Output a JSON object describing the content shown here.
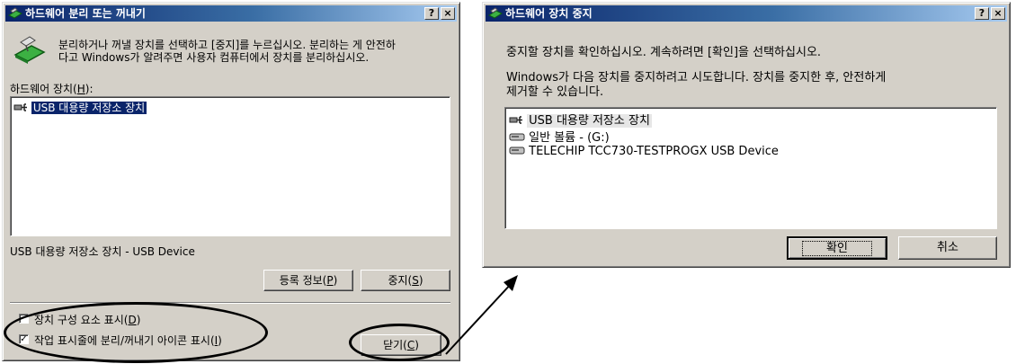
{
  "dialog1": {
    "title": "하드웨어 분리 또는 꺼내기",
    "help_btn": "?",
    "close_btn": "×",
    "instruction_line1": "분리하거나 꺼낼 장치를 선택하고 [중지]를 누르십시오. 분리하는 게 안전하",
    "instruction_line2": "다고 Windows가 알려주면 사용자 컴퓨터에서 장치를 분리하십시오.",
    "list_label_pre": "하드웨어 장치(",
    "list_label_key": "H",
    "list_label_post": "):",
    "devices": [
      "USB 대용량 저장소 장치"
    ],
    "device_description": "USB 대용량 저장소 장치 - USB Device",
    "properties_btn_pre": "등록 정보(",
    "properties_btn_key": "P",
    "properties_btn_post": ")",
    "stop_btn_pre": "중지(",
    "stop_btn_key": "S",
    "stop_btn_post": ")",
    "show_components_pre": "장치 구성 요소 표시(",
    "show_components_key": "D",
    "show_components_post": ")",
    "show_components_checked": false,
    "show_icon_pre": "작업 표시줄에 분리/꺼내기 아이콘 표시(",
    "show_icon_key": "I",
    "show_icon_post": ")",
    "show_icon_checked": true,
    "close_dialog_btn_pre": "닫기(",
    "close_dialog_btn_key": "C",
    "close_dialog_btn_post": ")"
  },
  "dialog2": {
    "title": "하드웨어 장치 중지",
    "help_btn": "?",
    "close_btn": "×",
    "prompt": "중지할 장치를 확인하십시오. 계속하려면 [확인]을 선택하십시오.",
    "info_line1": "Windows가 다음 장치를 중지하려고 시도합니다. 장치를 중지한 후, 안전하게",
    "info_line2": "제거할 수 있습니다.",
    "devices": [
      "USB 대용량 저장소 장치",
      "일반 볼륨 - (G:)",
      "TELECHIP TCC730-TESTPROGX USB Device"
    ],
    "ok_btn": "확인",
    "cancel_btn": "취소"
  },
  "icons": [
    "hardware-remove-icon",
    "usb-device-icon",
    "drive-icon",
    "arrow-icon"
  ],
  "colors": {
    "titlebar_start": "#0a246a",
    "titlebar_end": "#a6caf0",
    "face": "#d4d0c8",
    "selection": "#0a246a"
  }
}
